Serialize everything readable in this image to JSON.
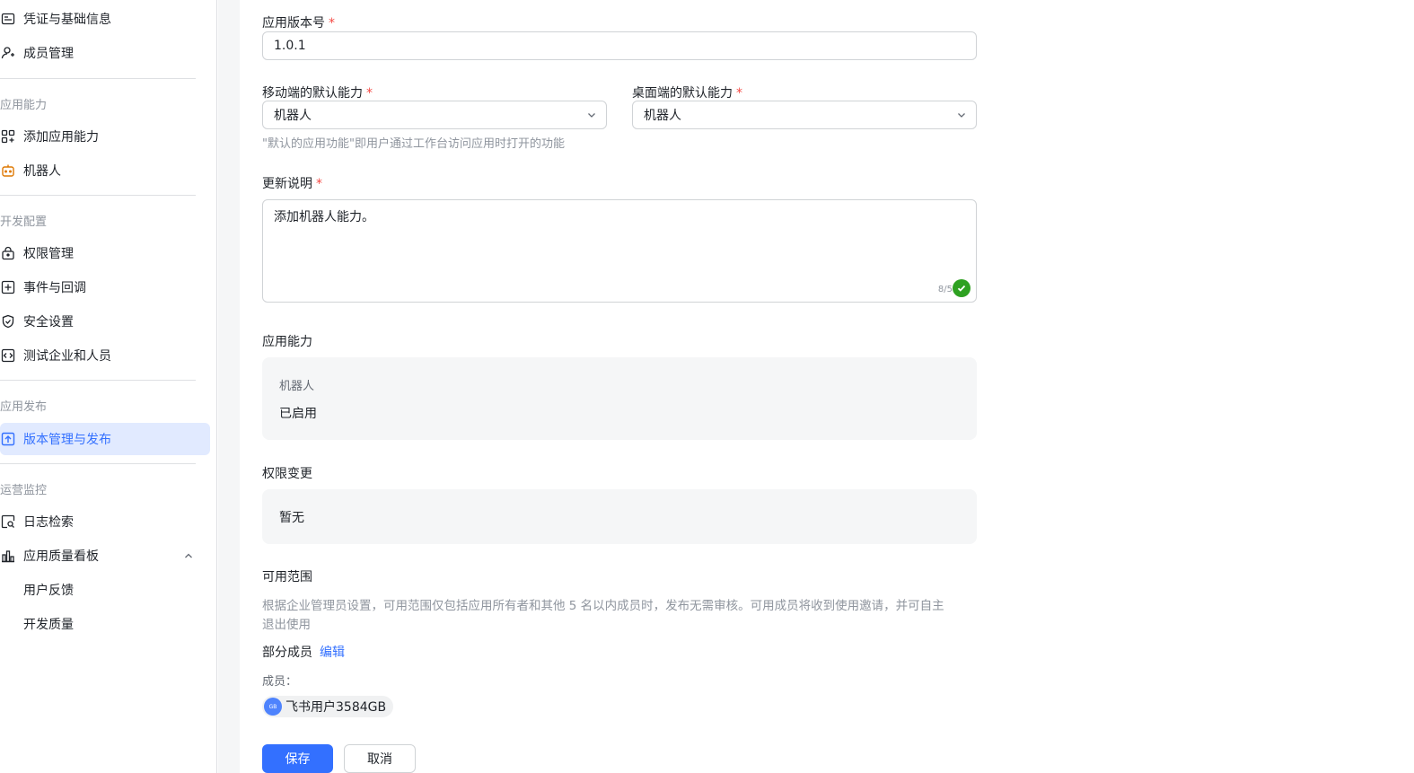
{
  "sidebar": {
    "top_items": [
      {
        "label": "凭证与基础信息",
        "icon": "credential-icon"
      },
      {
        "label": "成员管理",
        "icon": "member-icon"
      }
    ],
    "sections": [
      {
        "title": "应用能力",
        "items": [
          {
            "label": "添加应用能力",
            "icon": "grid-plus-icon"
          },
          {
            "label": "机器人",
            "icon": "robot-icon"
          }
        ]
      },
      {
        "title": "开发配置",
        "items": [
          {
            "label": "权限管理",
            "icon": "lock-icon"
          },
          {
            "label": "事件与回调",
            "icon": "event-icon"
          },
          {
            "label": "安全设置",
            "icon": "shield-icon"
          },
          {
            "label": "测试企业和人员",
            "icon": "code-icon"
          }
        ]
      },
      {
        "title": "应用发布",
        "items": [
          {
            "label": "版本管理与发布",
            "icon": "upload-icon"
          }
        ]
      },
      {
        "title": "运营监控",
        "items": [
          {
            "label": "日志检索",
            "icon": "log-search-icon"
          },
          {
            "label": "应用质量看板",
            "icon": "bar-chart-icon"
          },
          {
            "label": "用户反馈",
            "icon": ""
          },
          {
            "label": "开发质量",
            "icon": ""
          }
        ]
      }
    ],
    "accent": "#3370ff"
  },
  "form": {
    "version_label": "应用版本号",
    "version_value": "1.0.1",
    "required_mark": "*",
    "mobile_label": "移动端的默认能力",
    "mobile_value": "机器人",
    "desktop_label": "桌面端的默认能力",
    "desktop_value": "机器人",
    "default_hint": "\"默认的应用功能\"即用户通过工作台访问应用时打开的功能",
    "notes_label": "更新说明",
    "notes_value": "添加机器人能力。",
    "notes_counter": "8/5",
    "ability_label": "应用能力",
    "ability_name": "机器人",
    "ability_status": "已启用",
    "perm_label": "权限变更",
    "perm_value": "暂无",
    "scope_label": "可用范围",
    "scope_desc_1": "根据企业管理员设置，可用范围仅包括应用所有者和其他 5 名以内成员时，发布无需审核。可用成员将收到使用邀请，并可自主",
    "scope_desc_2": "退出使用",
    "partial_label": "部分成员",
    "edit_link": "编辑",
    "members_label": "成员：",
    "member_avatar": "GB",
    "member_name": "飞书用户3584GB",
    "save_button": "保存",
    "cancel_button": "取消"
  }
}
